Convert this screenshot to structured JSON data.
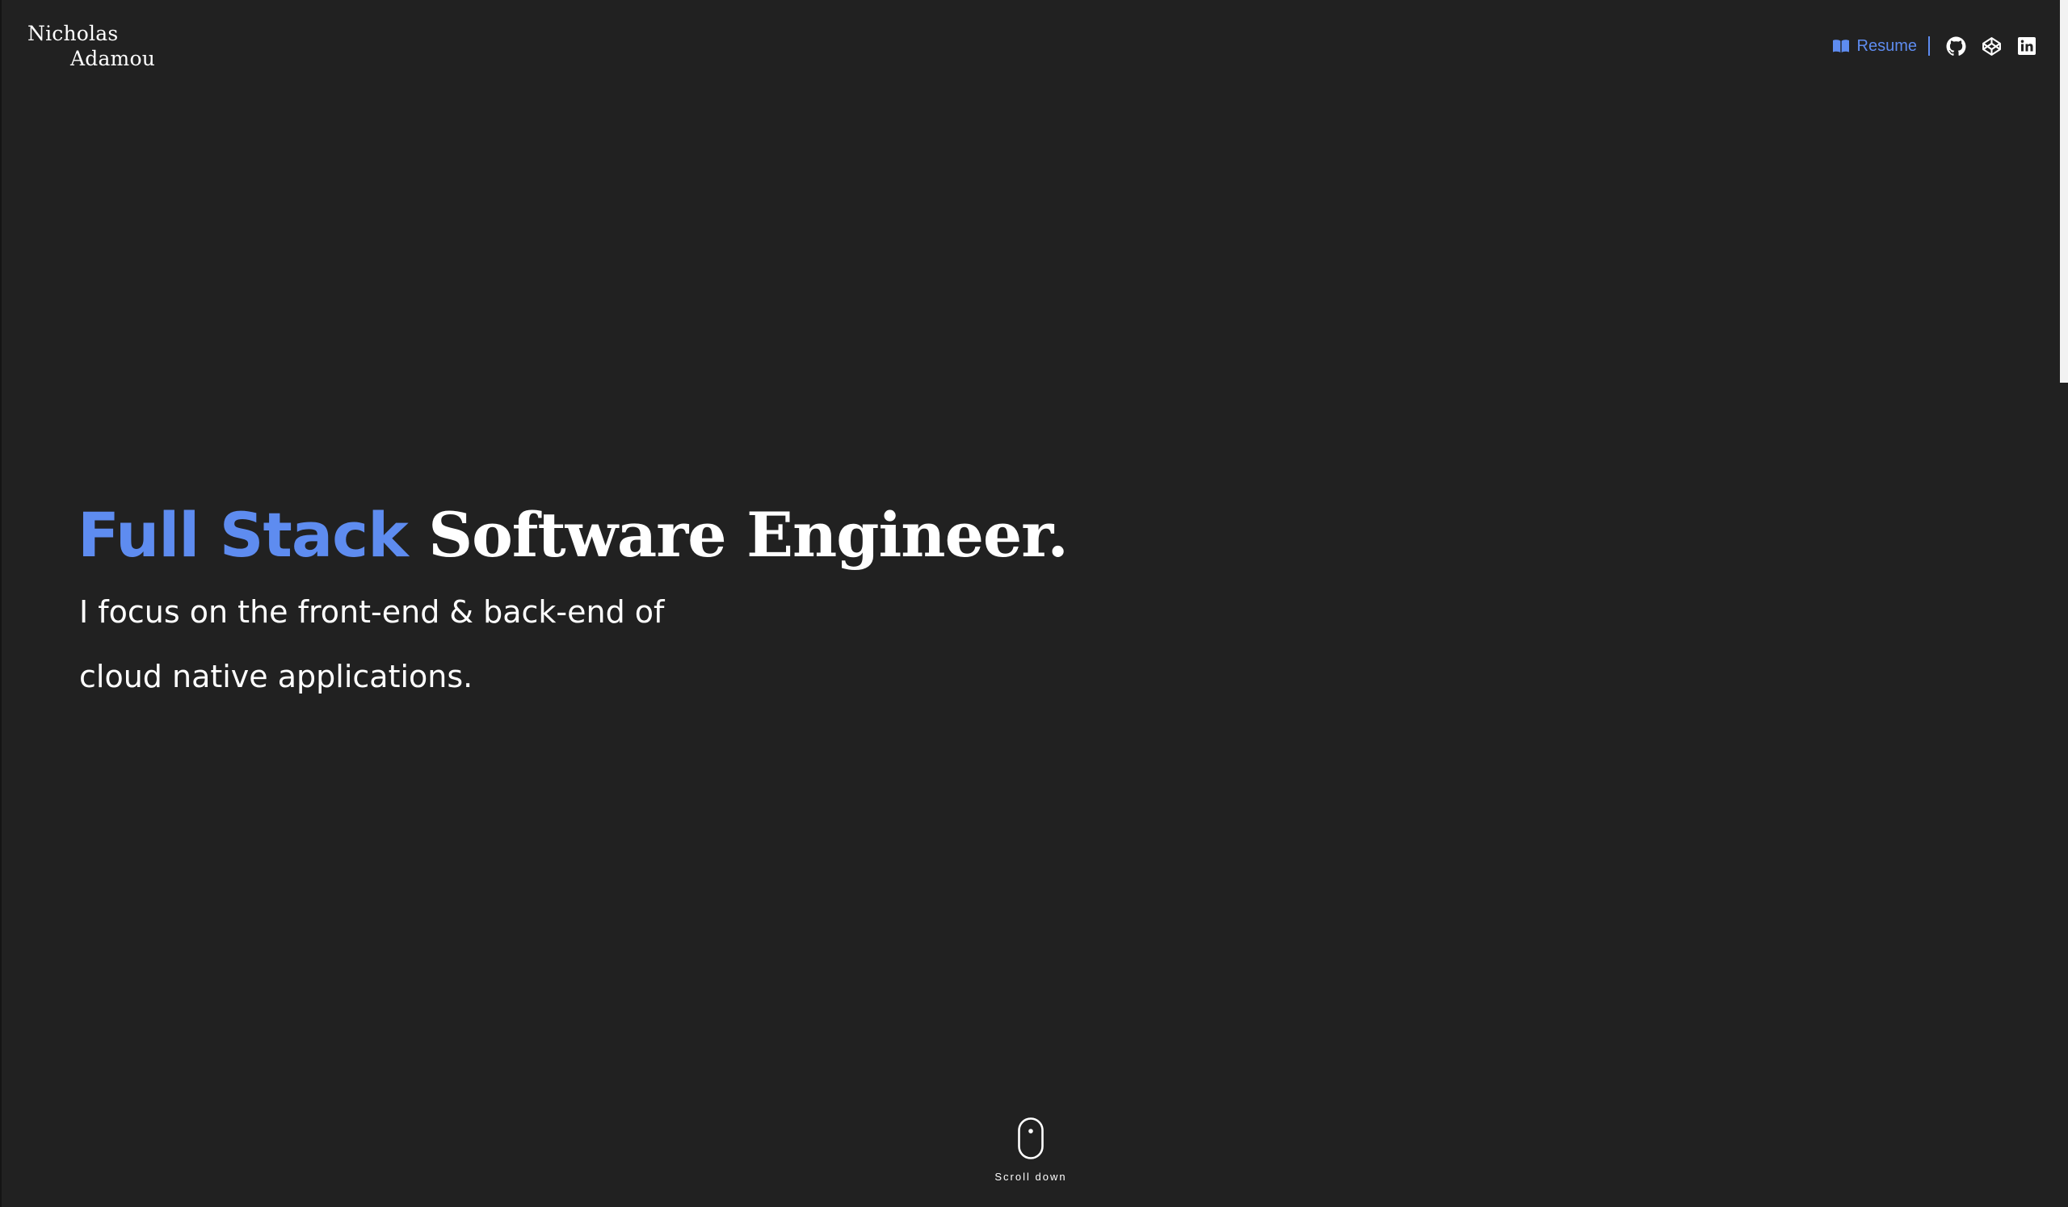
{
  "logo": {
    "line1": "Nicholas",
    "line2": "Adamou"
  },
  "nav": {
    "resume_label": "Resume",
    "resume_icon": "book-open-icon",
    "social": [
      {
        "icon": "github-icon"
      },
      {
        "icon": "codepen-icon"
      },
      {
        "icon": "linkedin-icon"
      }
    ]
  },
  "hero": {
    "title_accent": "Full Stack",
    "title_rest": "Software Engineer.",
    "subtitle_line1": "I focus on the front-end & back-end of",
    "subtitle_line2": "cloud native applications."
  },
  "scroll": {
    "label": "Scroll down",
    "icon": "mouse-icon"
  },
  "colors": {
    "background": "#212121",
    "accent": "#5e8cf0",
    "text": "#ffffff"
  }
}
